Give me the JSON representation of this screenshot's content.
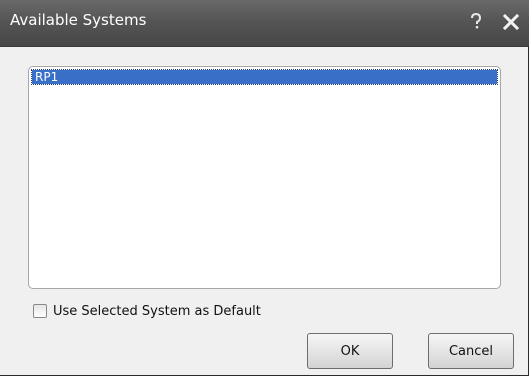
{
  "dialog": {
    "title": "Available Systems",
    "help_icon": "help-icon",
    "close_icon": "close-icon"
  },
  "systems_list": {
    "items": [
      {
        "label": "RP1",
        "selected": true
      }
    ]
  },
  "default_checkbox": {
    "label": "Use Selected System as Default",
    "checked": false
  },
  "buttons": {
    "ok_label": "OK",
    "cancel_label": "Cancel"
  },
  "colors": {
    "titlebar": "#555555",
    "selection": "#3a6fc8"
  }
}
